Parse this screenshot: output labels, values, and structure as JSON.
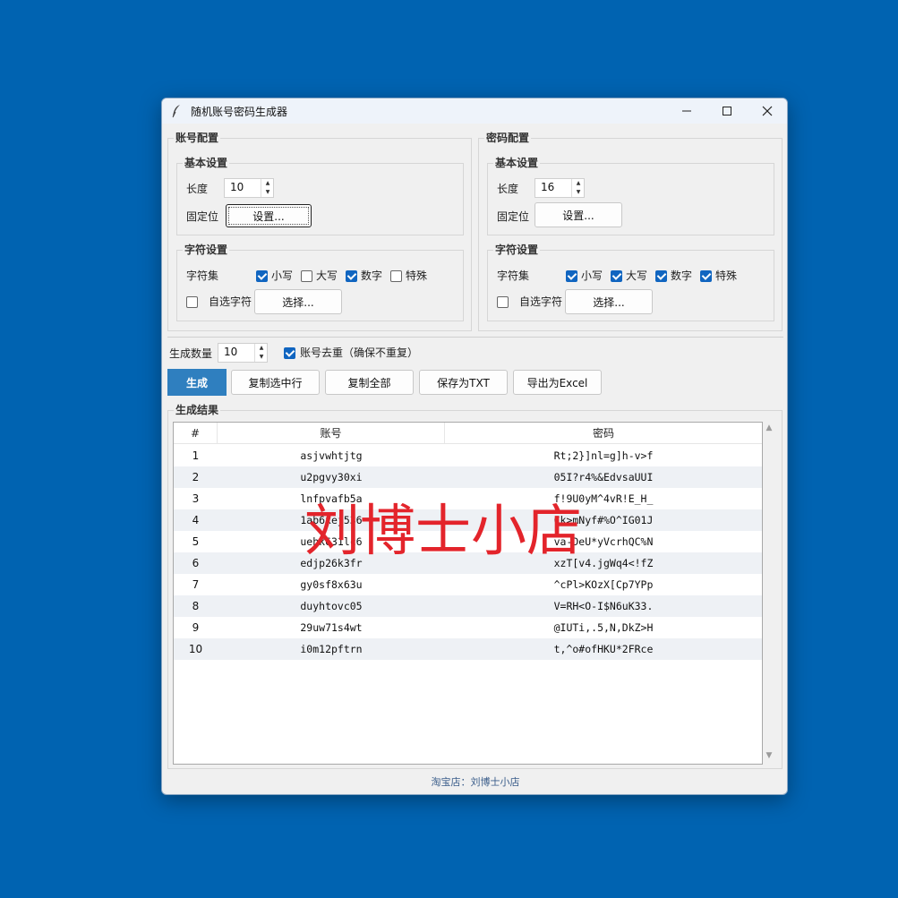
{
  "window": {
    "title": "随机账号密码生成器",
    "icon": "feather-icon"
  },
  "account": {
    "title": "账号配置",
    "basic_title": "基本设置",
    "length_label": "长度",
    "length_value": "10",
    "fixed_label": "固定位",
    "fixed_button": "设置...",
    "char_title": "字符设置",
    "charset_label": "字符集",
    "lower": {
      "label": "小写",
      "checked": true
    },
    "upper": {
      "label": "大写",
      "checked": false
    },
    "digit": {
      "label": "数字",
      "checked": true
    },
    "special": {
      "label": "特殊",
      "checked": false
    },
    "custom_label": "自选字符",
    "custom_checked": false,
    "choose_button": "选择..."
  },
  "password": {
    "title": "密码配置",
    "basic_title": "基本设置",
    "length_label": "长度",
    "length_value": "16",
    "fixed_label": "固定位",
    "fixed_button": "设置...",
    "char_title": "字符设置",
    "charset_label": "字符集",
    "lower": {
      "label": "小写",
      "checked": true
    },
    "upper": {
      "label": "大写",
      "checked": true
    },
    "digit": {
      "label": "数字",
      "checked": true
    },
    "special": {
      "label": "特殊",
      "checked": true
    },
    "custom_label": "自选字符",
    "custom_checked": false,
    "choose_button": "选择..."
  },
  "options": {
    "count_label": "生成数量",
    "count_value": "10",
    "dedupe_label": "账号去重（确保不重复）",
    "dedupe_checked": true
  },
  "actions": {
    "generate": "生成",
    "copy_selected": "复制选中行",
    "copy_all": "复制全部",
    "save_txt": "保存为TXT",
    "export_excel": "导出为Excel"
  },
  "results": {
    "title": "生成结果",
    "columns": [
      "#",
      "账号",
      "密码"
    ],
    "rows": [
      {
        "n": "1",
        "account": "asjvwhtjtg",
        "password": "Rt;2}]nl=g]h-v>f"
      },
      {
        "n": "2",
        "account": "u2pgvy30xi",
        "password": "05I?r4%&EdvsaUUI"
      },
      {
        "n": "3",
        "account": "lnfpvafb5a",
        "password": "f!9U0yM^4vR!E_H_"
      },
      {
        "n": "4",
        "account": "1ab6xej536",
        "password": "Ck>mNyf#%O^IG01J"
      },
      {
        "n": "5",
        "account": "uehk631lc6",
        "password": "va-DeU*yVcrhQC%N"
      },
      {
        "n": "6",
        "account": "edjp26k3fr",
        "password": "xzT[v4.jgWq4<!fZ"
      },
      {
        "n": "7",
        "account": "gy0sf8x63u",
        "password": "^cPl>KOzX[Cp7YPp"
      },
      {
        "n": "8",
        "account": "duyhtovc05",
        "password": "V=RH<O-I$N6uK33."
      },
      {
        "n": "9",
        "account": "29uw71s4wt",
        "password": "@IUTi,.5,N,DkZ>H"
      },
      {
        "n": "10",
        "account": "i0m12pftrn",
        "password": "t,^o#ofHKU*2FRce"
      }
    ]
  },
  "footer": "淘宝店：刘博士小店",
  "watermark": "刘博士小店",
  "colors": {
    "desktop": "#0063b1",
    "generate_button": "#2f7fbf",
    "checkbox_on": "#1065c0",
    "watermark": "#e3242b"
  }
}
